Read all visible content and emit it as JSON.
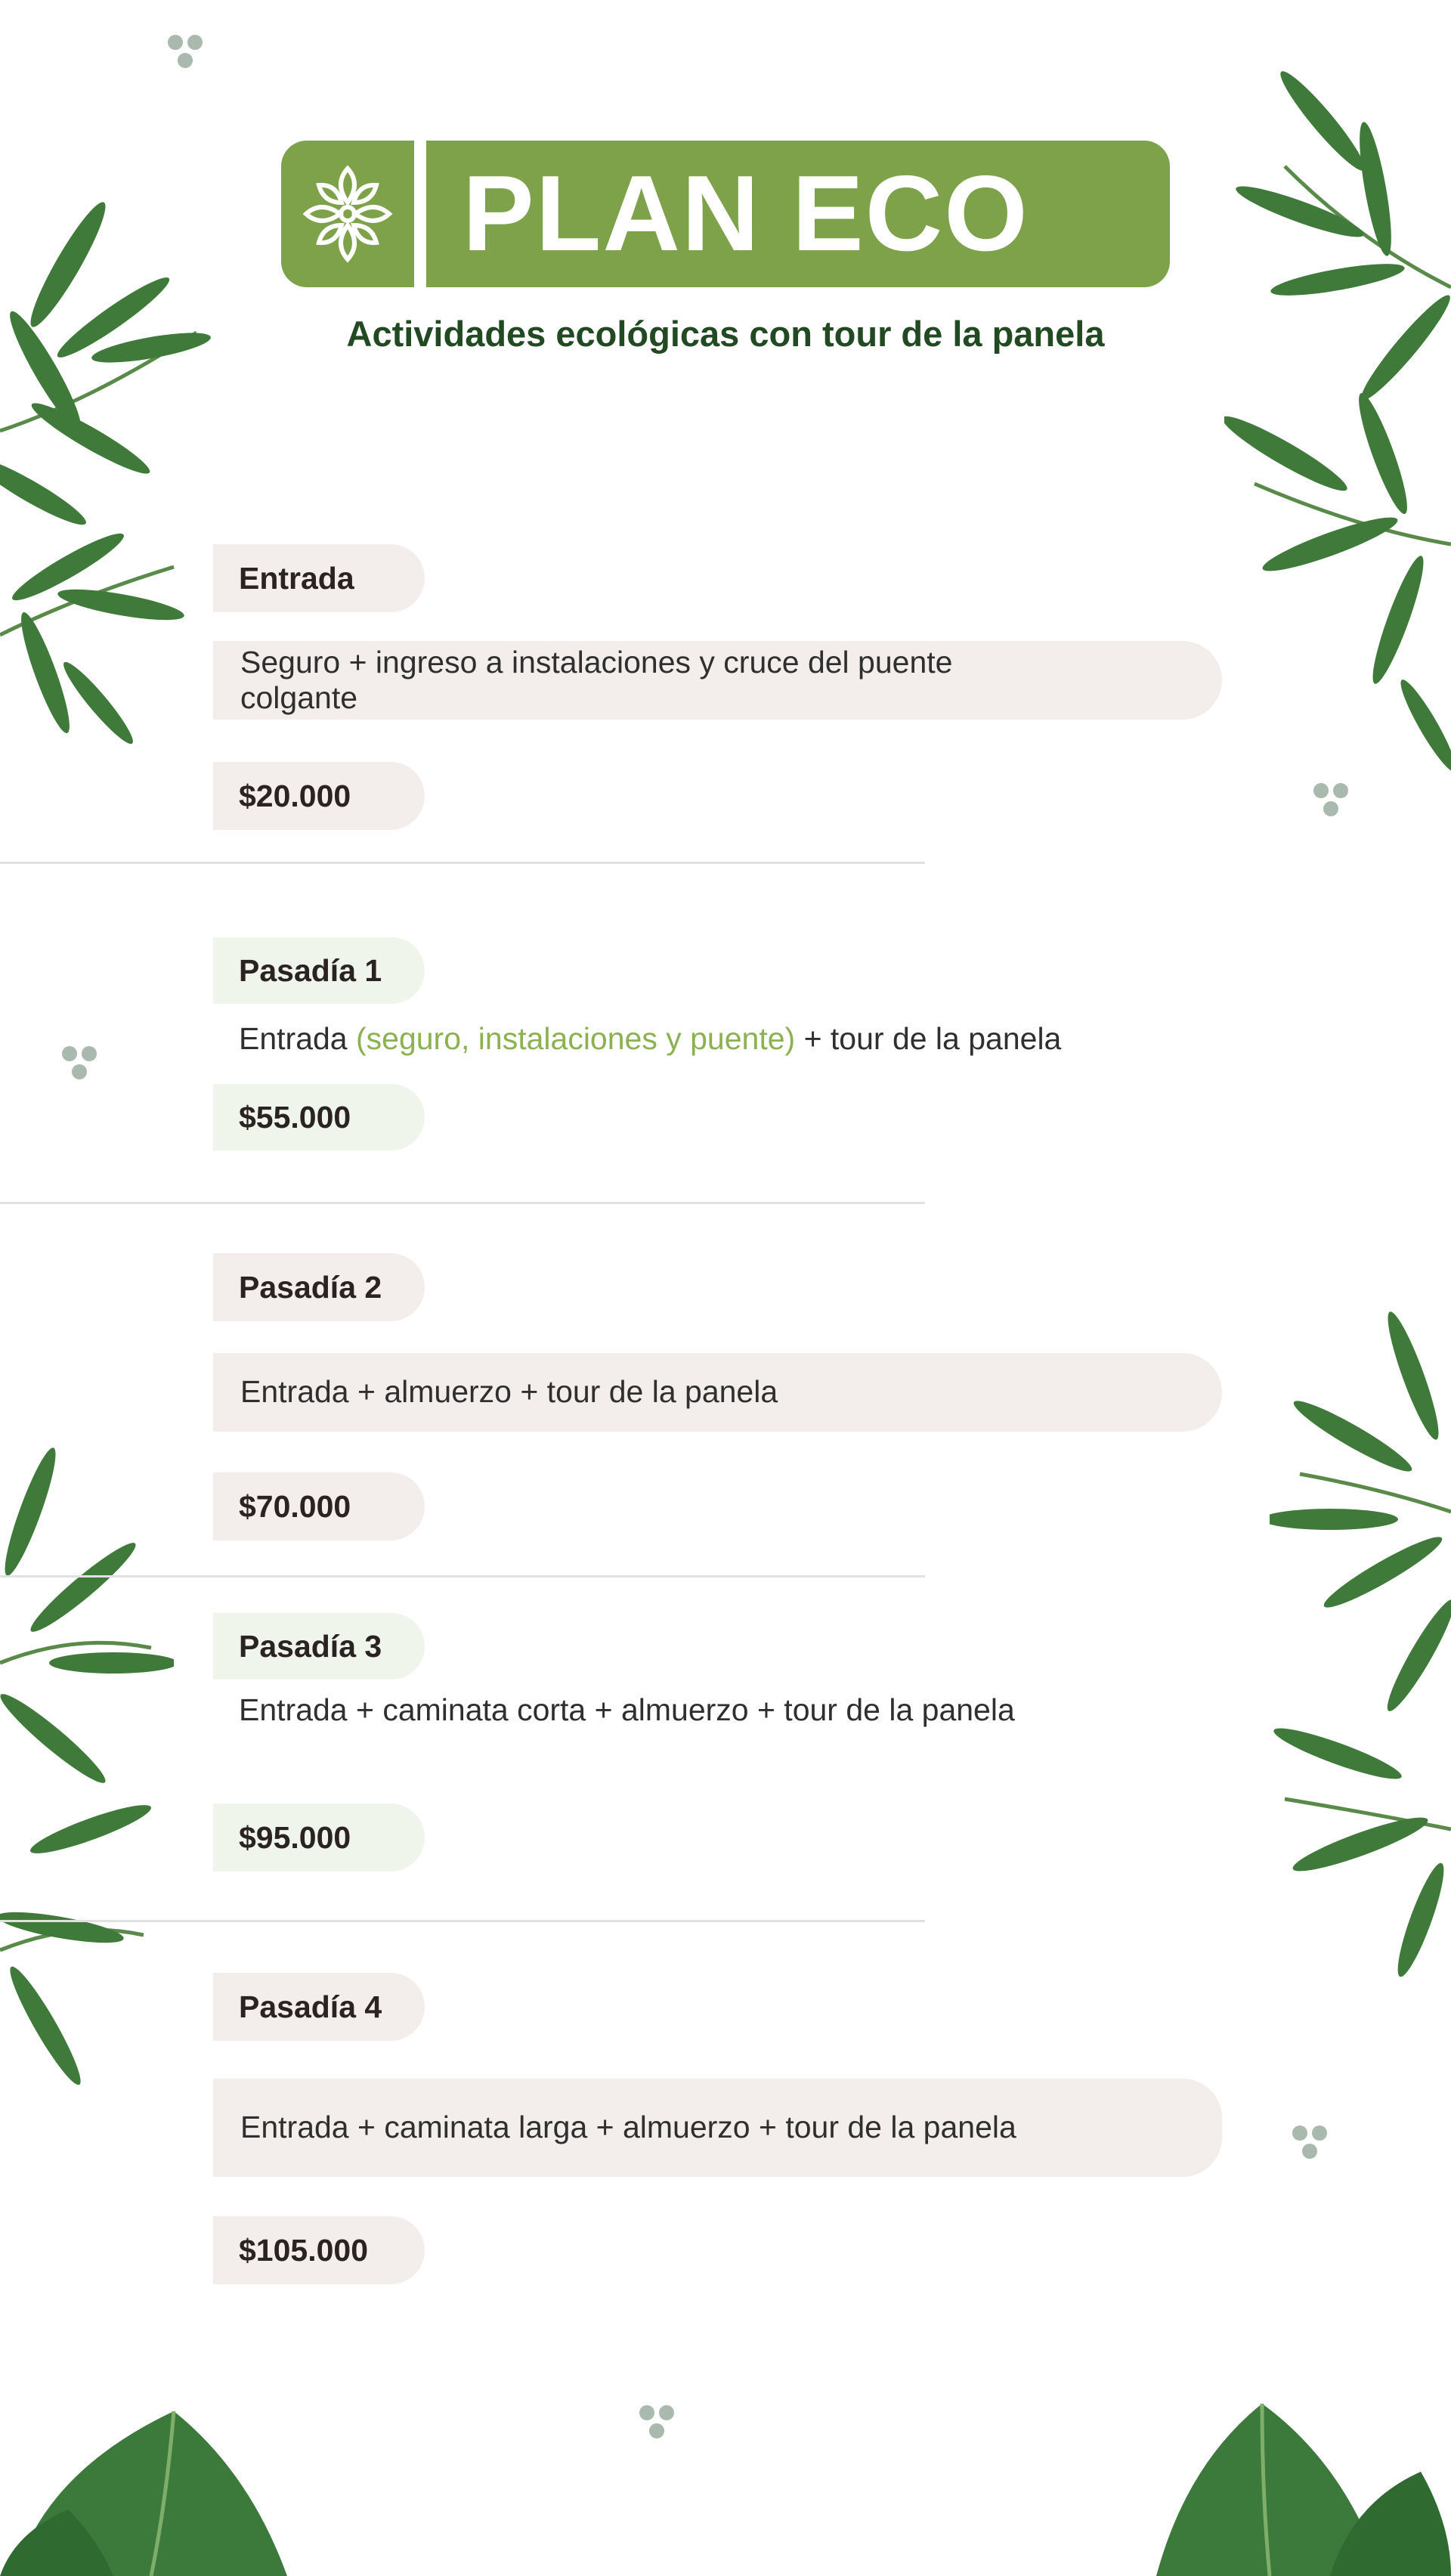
{
  "header": {
    "title": "PLAN ECO",
    "subtitle": "Actividades ecológicas con tour de la panela",
    "logo_icon": "leaf-ornament-icon",
    "accent_color": "#7ea24a"
  },
  "plans": [
    {
      "name": "Entrada",
      "description": "Seguro + ingreso a instalaciones y cruce del puente colgante",
      "price": "$20.000"
    },
    {
      "name": "Pasadía 1",
      "description_prefix": "Entrada ",
      "description_highlight": "(seguro, instalaciones y puente)",
      "description_suffix": " + tour de la panela",
      "price": "$55.000"
    },
    {
      "name": "Pasadía 2",
      "description": "Entrada +  almuerzo + tour de la panela",
      "price": "$70.000"
    },
    {
      "name": "Pasadía 3",
      "description": "Entrada + caminata corta + almuerzo + tour de la panela",
      "price": "$95.000"
    },
    {
      "name": "Pasadía 4",
      "description": "Entrada + caminata larga + almuerzo + tour de la panela",
      "price": "$105.000"
    }
  ],
  "decorations": {
    "leaf_icon": "palm-leaf-icon",
    "dots_icon": "three-dots-icon",
    "leaf_color": "#3f7a3a",
    "dots_color": "#a9b9ae"
  }
}
